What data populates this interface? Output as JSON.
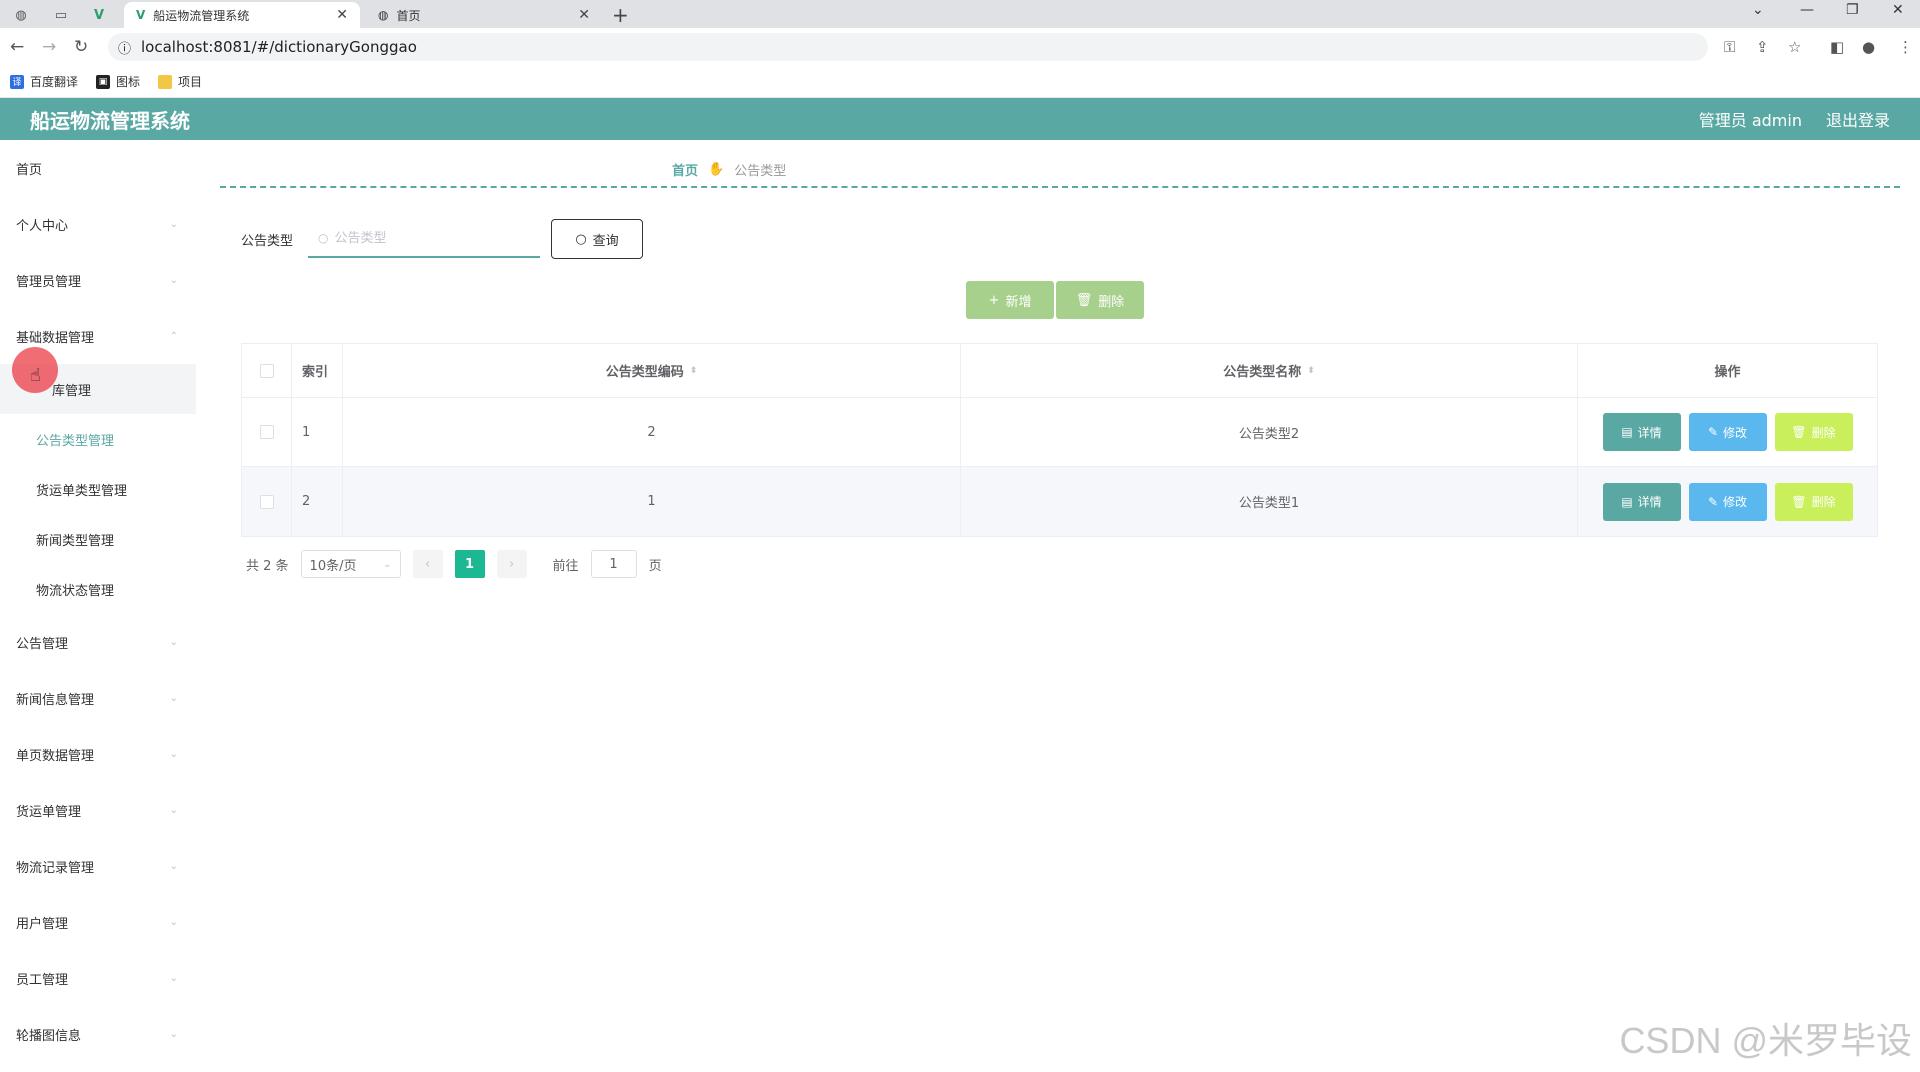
{
  "browser": {
    "tabs": [
      {
        "title": "船运物流管理系统",
        "active": true
      },
      {
        "title": "首页",
        "active": false
      }
    ],
    "url": "localhost:8081/#/dictionaryGonggao",
    "bookmarks": [
      "百度翻译",
      "图标",
      "项目"
    ]
  },
  "header": {
    "title": "船运物流管理系统",
    "user": "管理员 admin",
    "logout": "退出登录",
    "color": "#5aa8a3"
  },
  "sidebar": {
    "home": "首页",
    "personal": "个人中心",
    "admin": "管理员管理",
    "basic": "基础数据管理",
    "sub": [
      "仓库管理",
      "公告类型管理",
      "货运单类型管理",
      "新闻类型管理",
      "物流状态管理"
    ],
    "sub_partial": "库管理",
    "rest": [
      "公告管理",
      "新闻信息管理",
      "单页数据管理",
      "货运单管理",
      "物流记录管理",
      "用户管理",
      "员工管理",
      "轮播图信息"
    ]
  },
  "breadcrumb": {
    "home": "首页",
    "current": "公告类型"
  },
  "search": {
    "label": "公告类型",
    "placeholder": "公告类型",
    "button": "查询"
  },
  "actions": {
    "add": "新增",
    "delete": "删除"
  },
  "table": {
    "headers": {
      "index": "索引",
      "code": "公告类型编码",
      "name": "公告类型名称",
      "op": "操作"
    },
    "rows": [
      {
        "index": "1",
        "code": "2",
        "name": "公告类型2"
      },
      {
        "index": "2",
        "code": "1",
        "name": "公告类型1"
      }
    ],
    "ops": {
      "detail": "详情",
      "edit": "修改",
      "delete": "删除"
    }
  },
  "pager": {
    "total": "共 2 条",
    "size": "10条/页",
    "current": "1",
    "goto_prefix": "前往",
    "goto_value": "1",
    "goto_suffix": "页"
  },
  "watermark": "CSDN @米罗毕设"
}
